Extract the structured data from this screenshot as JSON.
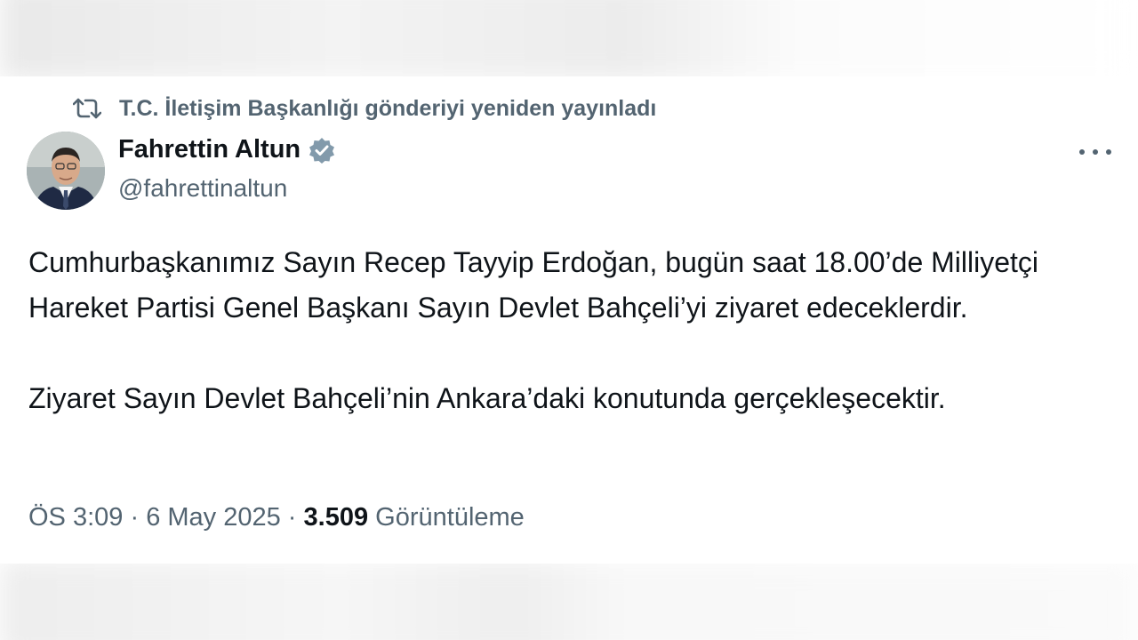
{
  "repost": {
    "icon": "repost-icon",
    "text": "T.C. İletişim Başkanlığı gönderiyi yeniden yayınladı"
  },
  "author": {
    "name": "Fahrettin Altun",
    "handle": "@fahrettinaltun",
    "verified": true,
    "verified_color": "#829aab"
  },
  "tweet": {
    "paragraph1": "Cumhurbaşkanımız Sayın Recep Tayyip Erdoğan, bugün saat 18.00’de Milliyetçi Hareket Partisi Genel Başkanı Sayın Devlet Bahçeli’yi ziyaret edeceklerdir.",
    "paragraph2": "Ziyaret Sayın Devlet Bahçeli’nin Ankara’daki konutunda gerçekleşecektir."
  },
  "meta": {
    "time": "ÖS 3:09",
    "separator": " · ",
    "date": "6 May 2025",
    "views_count": "3.509",
    "views_label": "Görüntüleme"
  },
  "colors": {
    "text_primary": "#0f1419",
    "text_secondary": "#536471"
  }
}
